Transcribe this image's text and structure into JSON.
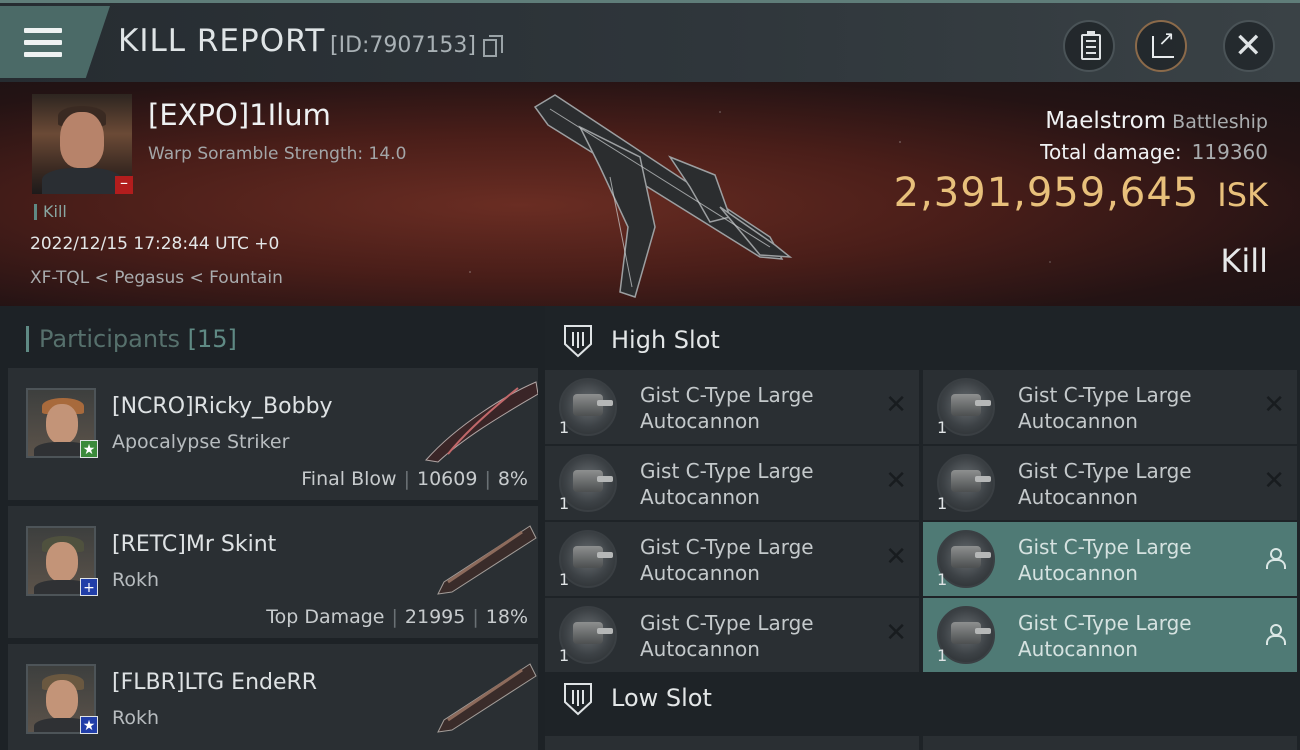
{
  "header": {
    "title": "KILL REPORT",
    "report_id": "[ID:7907153]",
    "icons": [
      "menu-icon",
      "copy-icon",
      "clipboard-icon",
      "share-icon",
      "close-icon"
    ]
  },
  "victim": {
    "name": "[EXPO]1Ilum",
    "scramble": "Warp Soramble Strength: 14.0",
    "tag": "Kill",
    "timestamp": "2022/12/15 17:28:44 UTC +0",
    "location": "XF-TQL < Pegasus < Fountain",
    "ship": "Maelstrom",
    "ship_class": "Battleship",
    "total_damage_label": "Total damage:",
    "total_damage": "119360",
    "isk_value": "2,391,959,645",
    "isk_unit": "ISK",
    "kind": "Kill"
  },
  "participants": {
    "label": "Participants",
    "count": "[15]",
    "rows": [
      {
        "name": "[NCRO]Ricky_Bobby",
        "ship": "Apocalypse Striker",
        "role": "Final Blow",
        "damage": "10609",
        "percent": "8%",
        "badge": "★"
      },
      {
        "name": "[RETC]Mr Skint",
        "ship": "Rokh",
        "role": "Top Damage",
        "damage": "21995",
        "percent": "18%",
        "badge": "+"
      },
      {
        "name": "[FLBR]LTG EndeRR",
        "ship": "Rokh",
        "role": "",
        "damage": "",
        "percent": "",
        "badge": "★"
      }
    ]
  },
  "high_slot": {
    "label": "High Slot",
    "modules": [
      {
        "qty": "1",
        "line1": "Gist C-Type Large",
        "line2": "Autocannon"
      },
      {
        "qty": "1",
        "line1": "Gist C-Type Large",
        "line2": "Autocannon"
      },
      {
        "qty": "1",
        "line1": "Gist C-Type Large",
        "line2": "Autocannon"
      },
      {
        "qty": "1",
        "line1": "Gist C-Type Large",
        "line2": "Autocannon"
      },
      {
        "qty": "1",
        "line1": "Gist C-Type Large",
        "line2": "Autocannon"
      },
      {
        "qty": "1",
        "line1": "Gist C-Type Large",
        "line2": "Autocannon"
      },
      {
        "qty": "1",
        "line1": "Gist C-Type Large",
        "line2": "Autocannon"
      },
      {
        "qty": "1",
        "line1": "Gist C-Type Large",
        "line2": "Autocannon"
      }
    ]
  },
  "low_slot": {
    "label": "Low Slot"
  },
  "colors": {
    "accent": "#5f8a84",
    "isk": "#e8c07b",
    "active_module": "#4f7a75",
    "badge_green": "#3b8a3b",
    "badge_blue": "#213ea8",
    "badge_red": "#b21d1d"
  }
}
